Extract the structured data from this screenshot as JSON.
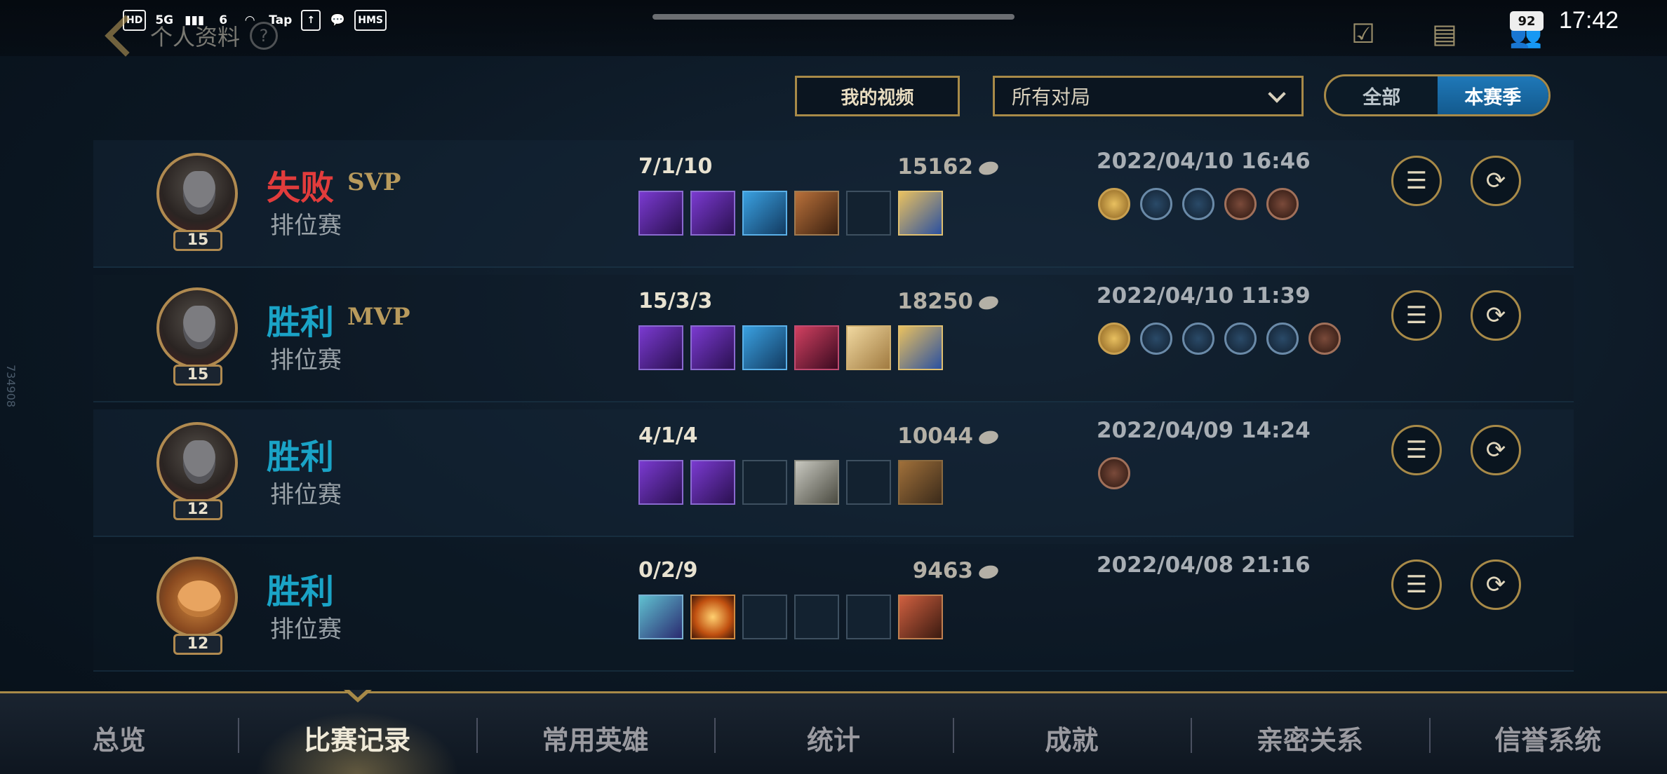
{
  "status_bar": {
    "icons": [
      "HD",
      "5G",
      "signal-icon",
      "6",
      "wifi-icon",
      "Tap",
      "upload-icon",
      "chat-bubble-icon",
      "HMS"
    ],
    "battery": "92",
    "time": "17:42"
  },
  "header": {
    "back_title": "个人资料",
    "help": "?"
  },
  "filters": {
    "my_video": "我的视频",
    "match_filter": "所有对局",
    "toggle": [
      "全部",
      "本赛季"
    ],
    "toggle_active": 1
  },
  "matches": [
    {
      "result": "失败",
      "result_type": "lose",
      "tag": "SVP",
      "mode": "排位赛",
      "level": "15",
      "hero": "dark-hero",
      "kda": "7/1/10",
      "gold": "15162",
      "datetime": "2022/04/10 16:46",
      "items": [
        "purple",
        "purple",
        "blue",
        "brown",
        "empty",
        "gold"
      ],
      "badges": [
        "gold",
        "blue",
        "blue",
        "bronze",
        "bronze"
      ]
    },
    {
      "result": "胜利",
      "result_type": "win",
      "tag": "MVP",
      "mode": "排位赛",
      "level": "15",
      "hero": "dark-hero",
      "kda": "15/3/3",
      "gold": "18250",
      "datetime": "2022/04/10 11:39",
      "items": [
        "purple",
        "purple",
        "blue",
        "red",
        "light",
        "gold"
      ],
      "badges": [
        "gold",
        "blue",
        "blue",
        "blue",
        "blue",
        "bronze"
      ]
    },
    {
      "result": "胜利",
      "result_type": "win",
      "tag": "",
      "mode": "排位赛",
      "level": "12",
      "hero": "dark-hero",
      "kda": "4/1/4",
      "gold": "10044",
      "datetime": "2022/04/09 14:24",
      "items": [
        "purple",
        "purple",
        "empty",
        "steel",
        "empty",
        "boot"
      ],
      "badges": [
        "bronze"
      ]
    },
    {
      "result": "胜利",
      "result_type": "win",
      "tag": "",
      "mode": "排位赛",
      "level": "12",
      "hero": "teemo",
      "kda": "0/2/9",
      "gold": "9463",
      "datetime": "2022/04/08 21:16",
      "items": [
        "teal",
        "orange",
        "empty",
        "empty",
        "empty",
        "maw"
      ],
      "badges": []
    }
  ],
  "tabs": [
    "总览",
    "比赛记录",
    "常用英雄",
    "统计",
    "成就",
    "亲密关系",
    "信誉系统"
  ],
  "active_tab": 1,
  "side_id": "734908",
  "colors": {
    "accent_gold": "#a88a48",
    "win": "#1aa3c6",
    "lose": "#e23c3c",
    "toggle_active": "#1f78b8"
  }
}
